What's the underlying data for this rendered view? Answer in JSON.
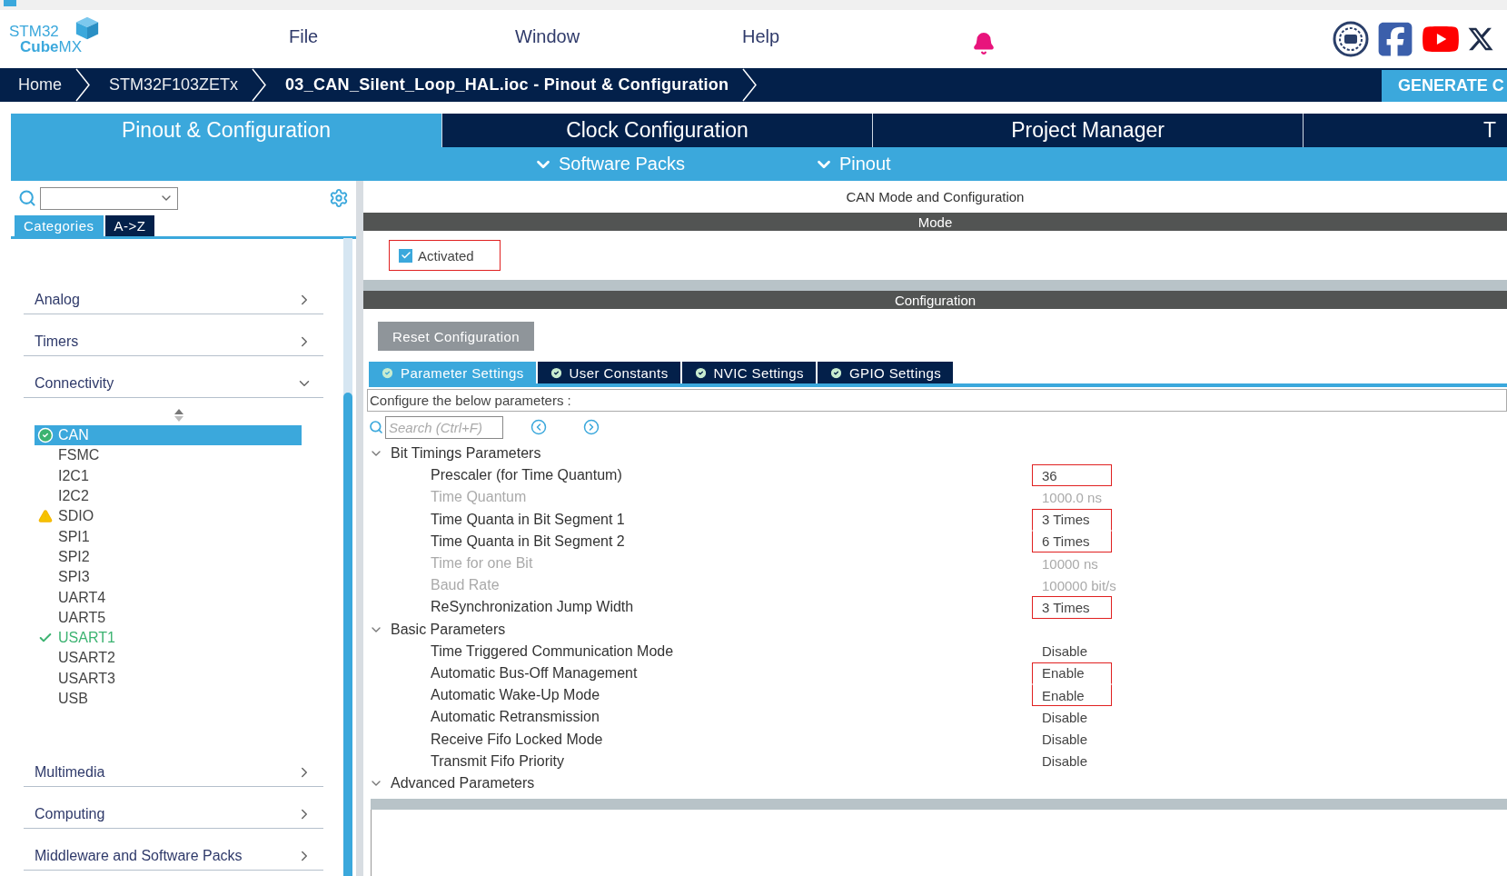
{
  "logo": {
    "top": "STM32",
    "bottom": "**Cube**MX"
  },
  "menu": [
    "File",
    "Window",
    "Help"
  ],
  "breadcrumb": [
    {
      "label": "Home",
      "current": false
    },
    {
      "label": "STM32F103ZETx",
      "current": false
    },
    {
      "label": "03_CAN_Silent_Loop_HAL.ioc - Pinout & Configuration",
      "current": true
    }
  ],
  "generate_button": "GENERATE C",
  "main_tabs": [
    {
      "label": "Pinout & Configuration",
      "selected": true
    },
    {
      "label": "Clock Configuration",
      "selected": false
    },
    {
      "label": "Project Manager",
      "selected": false
    },
    {
      "label": "T",
      "selected": false
    }
  ],
  "sub_menus": [
    "Software Packs",
    "Pinout"
  ],
  "sidebar": {
    "category_tabs": [
      {
        "label": "Categories",
        "selected": true
      },
      {
        "label": "A->Z",
        "selected": false
      }
    ],
    "categories": [
      {
        "label": "Analog",
        "expanded": false
      },
      {
        "label": "Timers",
        "expanded": false
      },
      {
        "label": "Connectivity",
        "expanded": true,
        "children": [
          {
            "label": "CAN",
            "kind": "configured",
            "selected": true
          },
          {
            "label": "FSMC",
            "kind": "plain",
            "selected": false
          },
          {
            "label": "I2C1",
            "kind": "plain",
            "selected": false
          },
          {
            "label": "I2C2",
            "kind": "plain",
            "selected": false
          },
          {
            "label": "SDIO",
            "kind": "warning",
            "selected": false
          },
          {
            "label": "SPI1",
            "kind": "plain",
            "selected": false
          },
          {
            "label": "SPI2",
            "kind": "plain",
            "selected": false
          },
          {
            "label": "SPI3",
            "kind": "plain",
            "selected": false
          },
          {
            "label": "UART4",
            "kind": "plain",
            "selected": false
          },
          {
            "label": "UART5",
            "kind": "plain",
            "selected": false
          },
          {
            "label": "USART1",
            "kind": "enabled",
            "selected": false
          },
          {
            "label": "USART2",
            "kind": "plain",
            "selected": false
          },
          {
            "label": "USART3",
            "kind": "plain",
            "selected": false
          },
          {
            "label": "USB",
            "kind": "plain",
            "selected": false
          }
        ]
      },
      {
        "label": "Multimedia",
        "expanded": false
      },
      {
        "label": "Computing",
        "expanded": false
      },
      {
        "label": "Middleware and Software Packs",
        "expanded": false
      }
    ]
  },
  "config": {
    "title": "CAN Mode and Configuration",
    "mode_header": "Mode",
    "activated": {
      "label": "Activated",
      "checked": true,
      "marked": true
    },
    "config_header": "Configuration",
    "reset_button": "Reset Configuration",
    "tabs": [
      {
        "label": "Parameter Settings",
        "selected": true
      },
      {
        "label": "User Constants",
        "selected": false
      },
      {
        "label": "NVIC Settings",
        "selected": false
      },
      {
        "label": "GPIO Settings",
        "selected": false
      }
    ],
    "hint": "Configure the below parameters :",
    "search": {
      "placeholder": "Search (Ctrl+F)"
    },
    "groups": [
      {
        "label": "Bit Timings Parameters",
        "expanded": true,
        "params": [
          {
            "name": "Prescaler (for Time Quantum)",
            "value": "36",
            "disabled": false,
            "marked": true
          },
          {
            "name": "Time Quantum",
            "value": "1000.0 ns",
            "disabled": true,
            "marked": false
          },
          {
            "name": "Time Quanta in Bit Segment 1",
            "value": "3 Times",
            "disabled": false,
            "marked": true
          },
          {
            "name": "Time Quanta in Bit Segment 2",
            "value": "6 Times",
            "disabled": false,
            "marked": true
          },
          {
            "name": "Time for one Bit",
            "value": "10000 ns",
            "disabled": true,
            "marked": false
          },
          {
            "name": "Baud Rate",
            "value": "100000 bit/s",
            "disabled": true,
            "marked": false
          },
          {
            "name": "ReSynchronization Jump Width",
            "value": "3 Times",
            "disabled": false,
            "marked": true
          }
        ]
      },
      {
        "label": "Basic Parameters",
        "expanded": true,
        "params": [
          {
            "name": "Time Triggered Communication Mode",
            "value": "Disable",
            "disabled": false,
            "marked": false
          },
          {
            "name": "Automatic Bus-Off Management",
            "value": "Enable",
            "disabled": false,
            "marked": true
          },
          {
            "name": "Automatic Wake-Up Mode",
            "value": "Enable",
            "disabled": false,
            "marked": true
          },
          {
            "name": "Automatic Retransmission",
            "value": "Disable",
            "disabled": false,
            "marked": false
          },
          {
            "name": "Receive Fifo Locked Mode",
            "value": "Disable",
            "disabled": false,
            "marked": false
          },
          {
            "name": "Transmit Fifo Priority",
            "value": "Disable",
            "disabled": false,
            "marked": false
          }
        ]
      },
      {
        "label": "Advanced Parameters",
        "expanded": true
      }
    ]
  }
}
